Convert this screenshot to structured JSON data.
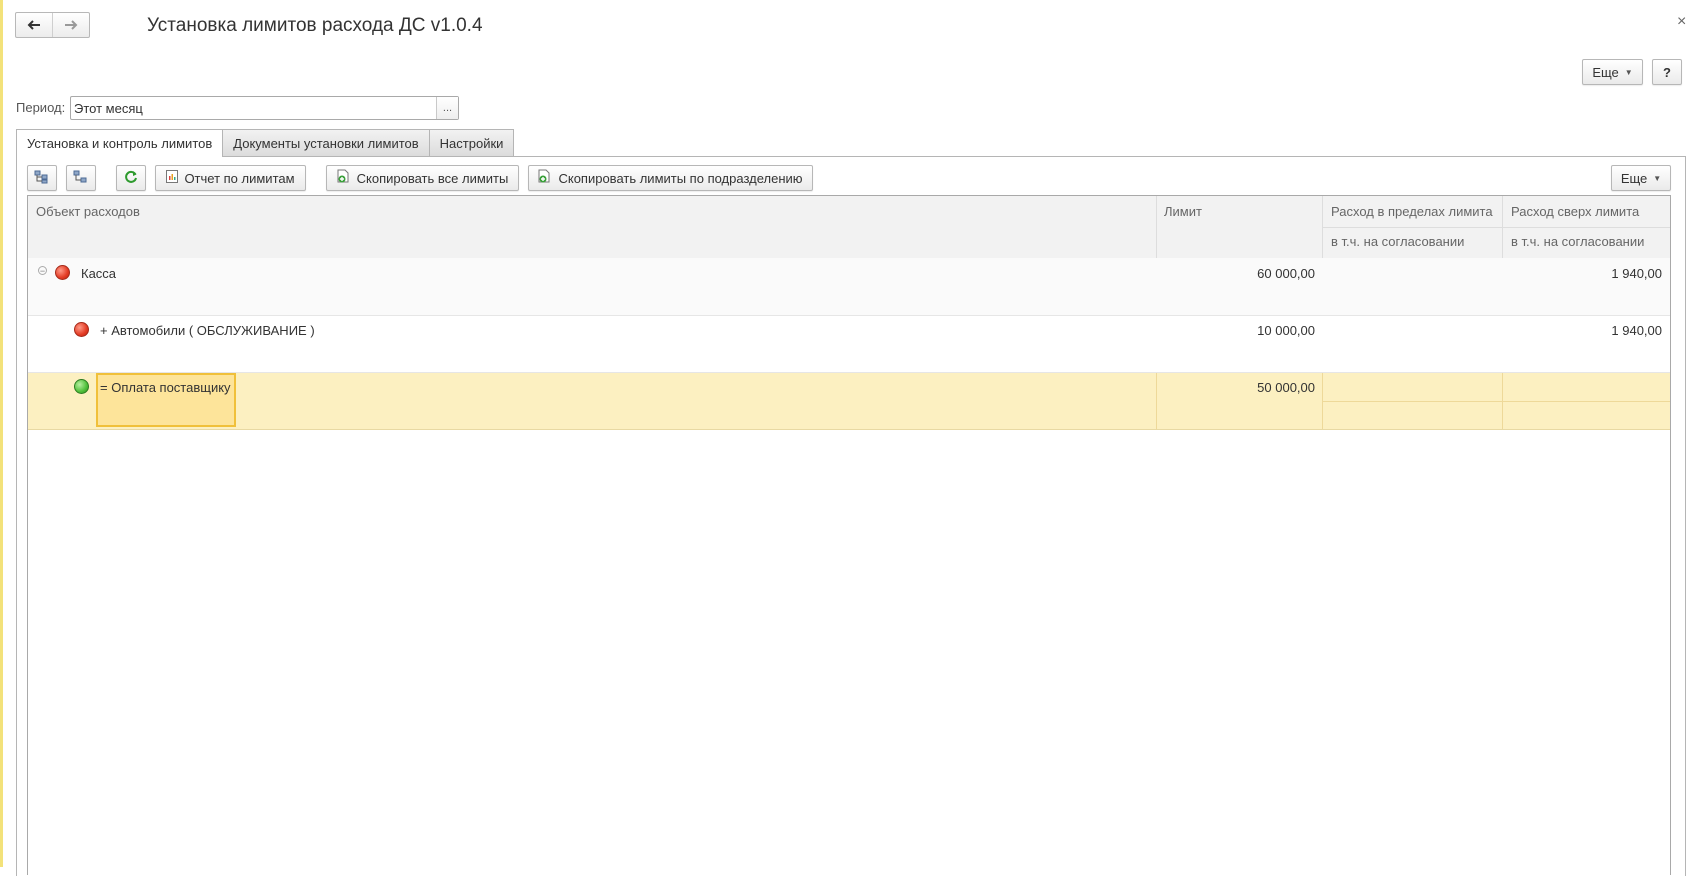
{
  "window": {
    "title": "Установка лимитов расхода ДС v1.0.4",
    "close_glyph": "×",
    "nav": {
      "back_icon": "arrow-left-icon",
      "forward_icon": "arrow-right-icon"
    }
  },
  "top_actions": {
    "more_label": "Еще",
    "help_label": "?"
  },
  "period": {
    "label": "Период:",
    "value": "Этот месяц",
    "choose_label": "..."
  },
  "tabs": [
    {
      "label": "Установка и контроль лимитов",
      "active": true
    },
    {
      "label": "Документы установки лимитов",
      "active": false
    },
    {
      "label": "Настройки",
      "active": false
    }
  ],
  "toolbar": {
    "expand_icon": "expand-tree-icon",
    "collapse_icon": "collapse-tree-icon",
    "refresh_icon": "refresh-icon",
    "report_label": "Отчет по лимитам",
    "copy_all_label": "Скопировать все лимиты",
    "copy_dept_label": "Скопировать лимиты по подразделению",
    "more_label": "Еще"
  },
  "table": {
    "columns": {
      "object": "Объект расходов",
      "limit": "Лимит",
      "within": "Расход в пределах лимита",
      "within_sub": "в т.ч. на согласовании",
      "over": "Расход сверх лимита",
      "over_sub": "в т.ч. на согласовании"
    },
    "rows": [
      {
        "name": "Касса",
        "status": "red",
        "limit": "60 000,00",
        "over": "1 940,00"
      },
      {
        "name": "+ Автомобили ( ОБСЛУЖИВАНИЕ )",
        "status": "red",
        "limit": "10 000,00",
        "over": "1 940,00"
      },
      {
        "name": "= Оплата поставщику",
        "status": "green",
        "limit": "50 000,00",
        "over": ""
      }
    ]
  },
  "colors": {
    "selected_row": "#fcf0c1",
    "focus_cell": "#fde49a",
    "status_red": "#e33b24",
    "status_green": "#4fbf3a"
  }
}
